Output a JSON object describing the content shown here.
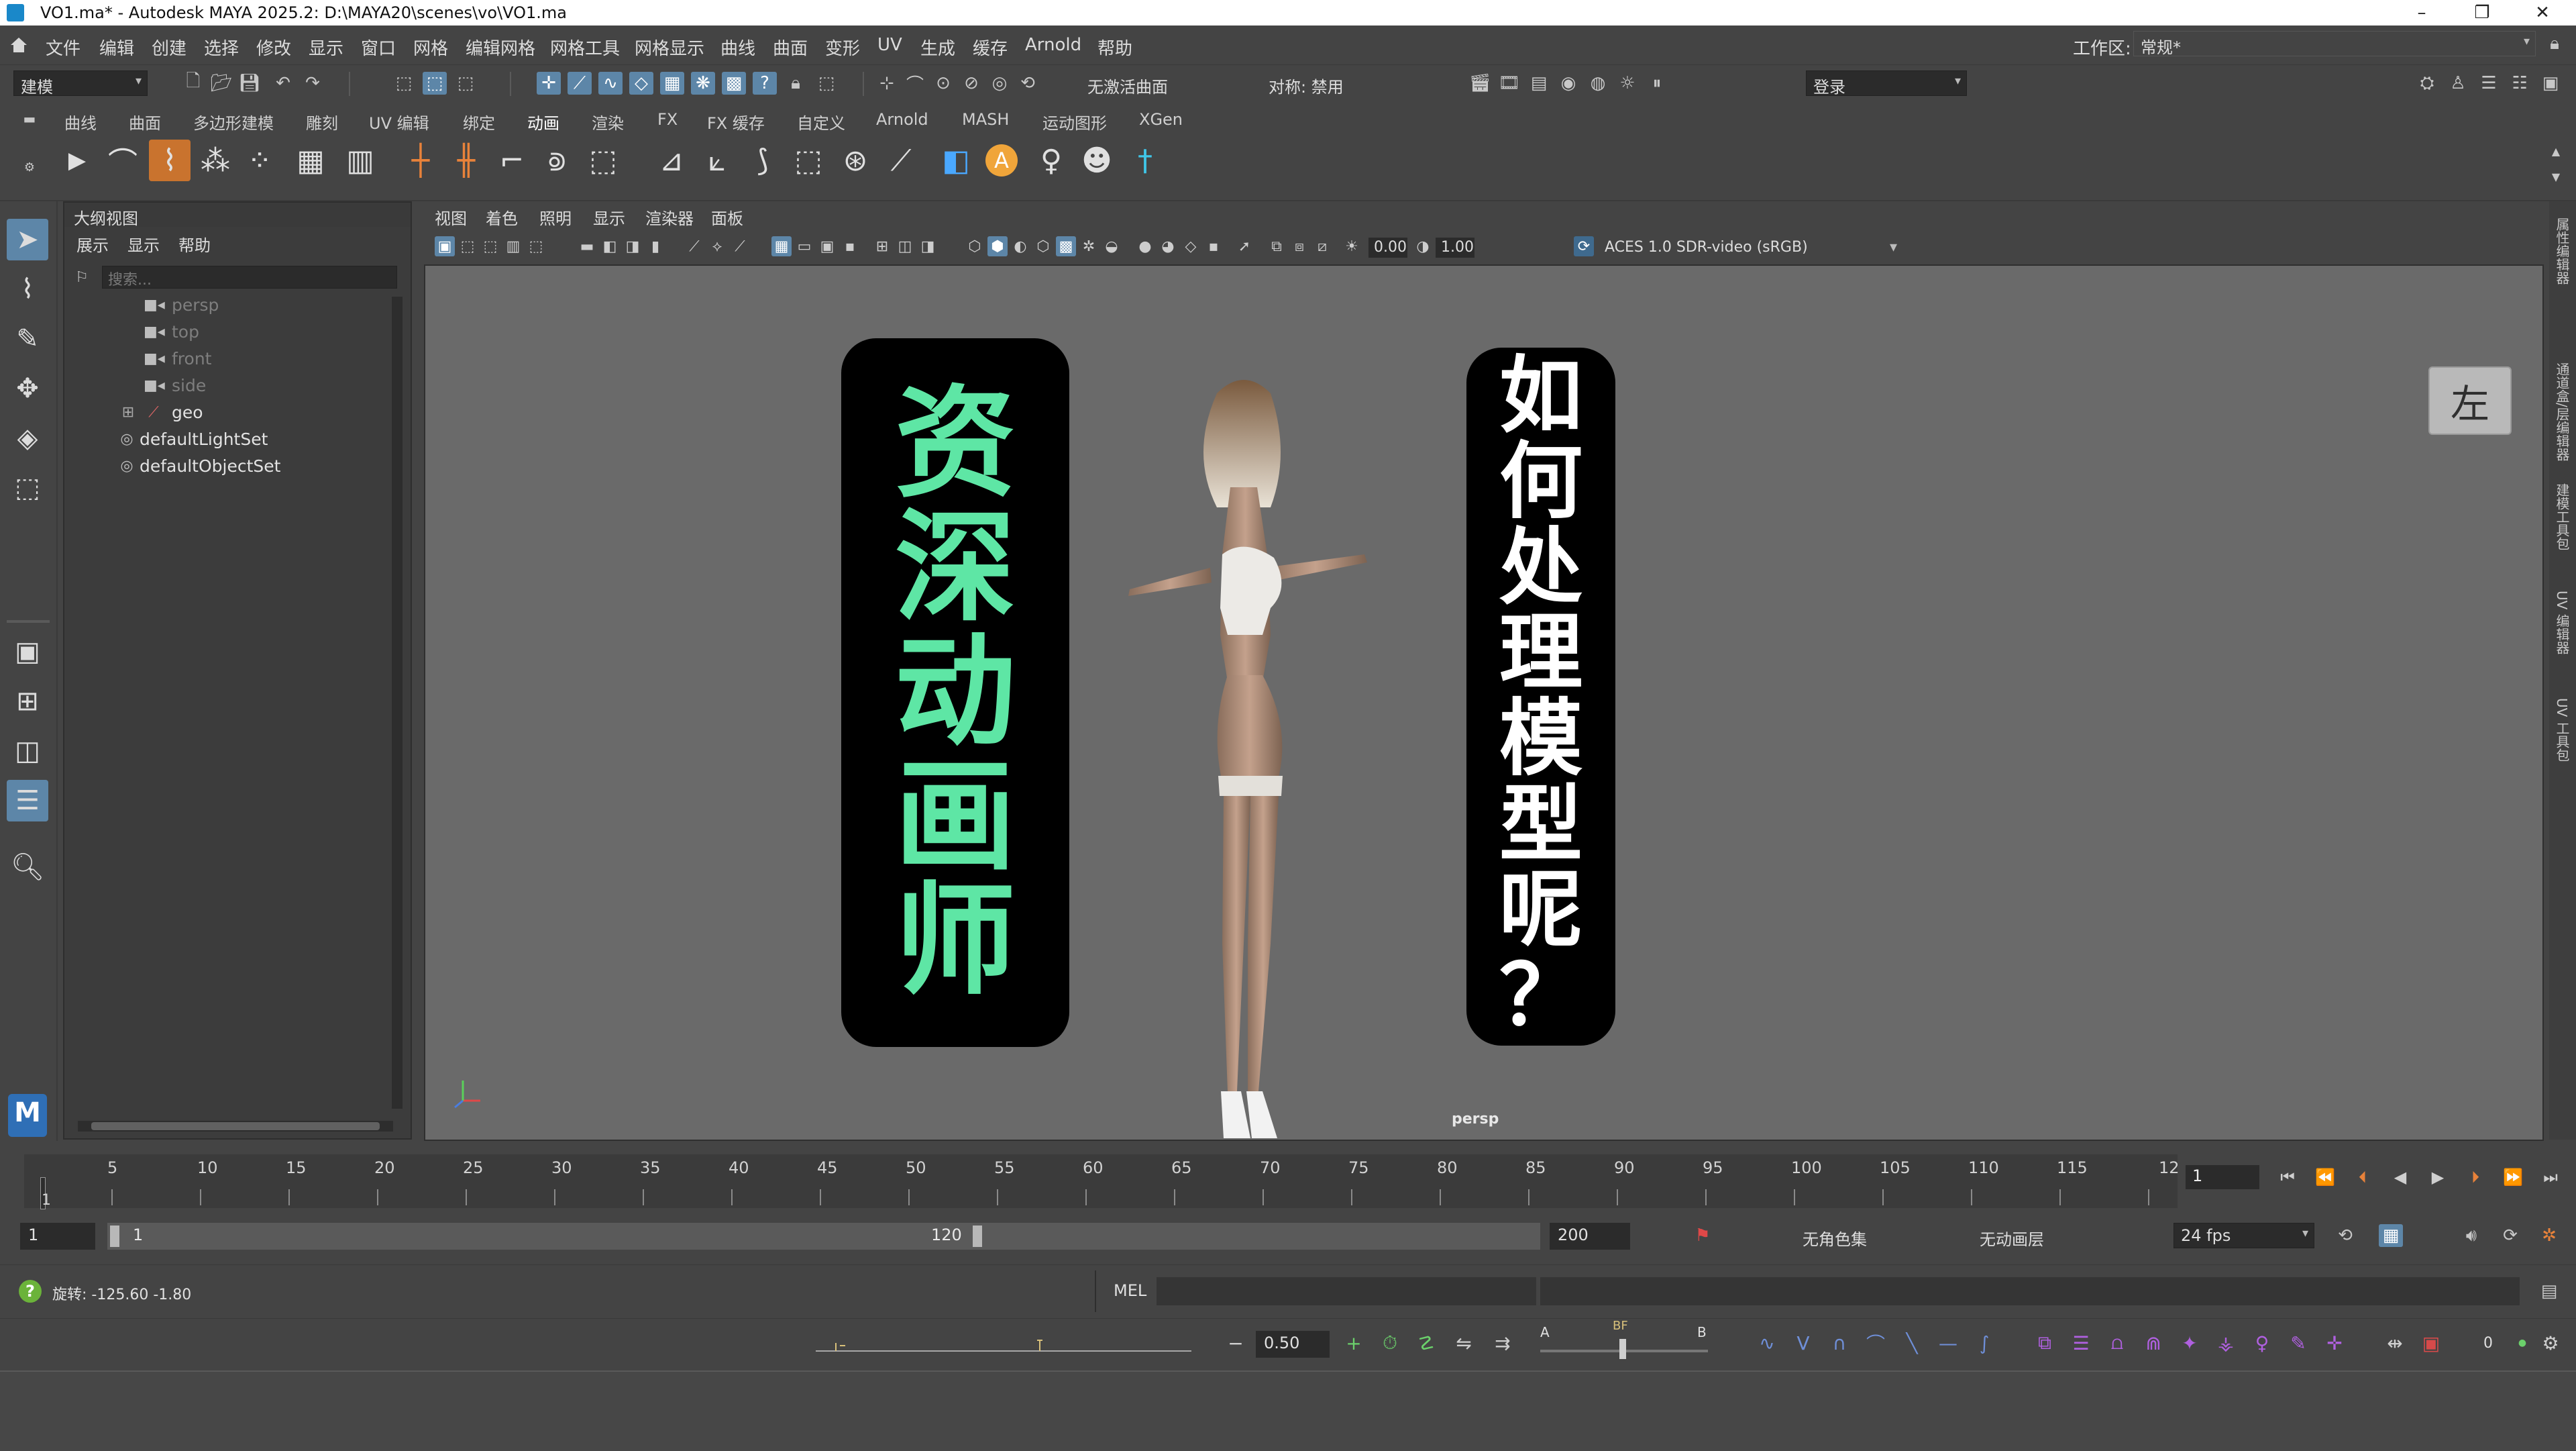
{
  "window": {
    "title": "VO1.ma* - Autodesk MAYA 2025.2: D:\\MAYA20\\scenes\\vo\\VO1.ma",
    "controls": [
      "–",
      "❐",
      "✕"
    ]
  },
  "menubar": {
    "items": [
      "文件",
      "编辑",
      "创建",
      "选择",
      "修改",
      "显示",
      "窗口",
      "网格",
      "编辑网格",
      "网格工具",
      "网格显示",
      "曲线",
      "曲面",
      "变形",
      "UV",
      "生成",
      "缓存",
      "Arnold",
      "帮助"
    ],
    "workspace_label": "工作区:",
    "workspace_value": "常规*"
  },
  "statusline": {
    "mode": "建模",
    "live_surface": "无激活曲面",
    "symmetry": "对称: 禁用",
    "login": "登录"
  },
  "shelf": {
    "tabs": [
      "曲线",
      "曲面",
      "多边形建模",
      "雕刻",
      "UV 编辑",
      "绑定",
      "动画",
      "渲染",
      "FX",
      "FX 缓存",
      "自定义",
      "Arnold",
      "MASH",
      "运动图形",
      "XGen"
    ],
    "active_tab": "动画"
  },
  "outliner": {
    "title": "大纲视图",
    "menu": [
      "展示",
      "显示",
      "帮助"
    ],
    "search_placeholder": "搜索...",
    "items": [
      {
        "label": "persp",
        "icon": "camera-icon"
      },
      {
        "label": "top",
        "icon": "camera-icon"
      },
      {
        "label": "front",
        "icon": "camera-icon"
      },
      {
        "label": "side",
        "icon": "camera-icon"
      },
      {
        "label": "geo",
        "icon": "transform-icon"
      },
      {
        "label": "defaultLightSet",
        "icon": "set-icon"
      },
      {
        "label": "defaultObjectSet",
        "icon": "set-icon"
      }
    ]
  },
  "viewport": {
    "menu": [
      "视图",
      "着色",
      "照明",
      "显示",
      "渲染器",
      "面板"
    ],
    "exposure": "0.00",
    "gamma": "1.00",
    "color_space": "ACES 1.0 SDR-video (sRGB)",
    "camera_label": "persp",
    "viewcube_label": "左",
    "banner_left": [
      "资",
      "深",
      "动",
      "画",
      "师"
    ],
    "banner_right": [
      "如",
      "何",
      "处",
      "理",
      "模",
      "型",
      "呢",
      "？"
    ],
    "colors": {
      "banner_left_text": "#5ee6a5",
      "banner_right_text": "#ffffff",
      "banner_bg": "#000000"
    }
  },
  "dock_tabs": [
    "属性编辑器",
    "通道盒/层编辑器",
    "建模工具包",
    "UV 编辑器",
    "UV 工具包"
  ],
  "timeslider": {
    "labels": [
      "5",
      "10",
      "15",
      "20",
      "25",
      "30",
      "35",
      "40",
      "45",
      "50",
      "55",
      "60",
      "65",
      "70",
      "75",
      "80",
      "85",
      "90",
      "95",
      "100",
      "105",
      "110",
      "115",
      "12"
    ],
    "start_label": "1",
    "current_frame": "1"
  },
  "range": {
    "start": "1",
    "inner_start": "1",
    "inner_end": "120",
    "end": "200",
    "character_set": "无角色集",
    "anim_layer": "无动画层",
    "fps": "24 fps"
  },
  "cmdline": {
    "rotation_text": "旋转: -125.60 -1.80",
    "mel_label": "MEL"
  },
  "graphstrip": {
    "weight_value": "0.50",
    "label_a": "A",
    "label_bf": "BF",
    "label_b": "B",
    "count": "0"
  }
}
